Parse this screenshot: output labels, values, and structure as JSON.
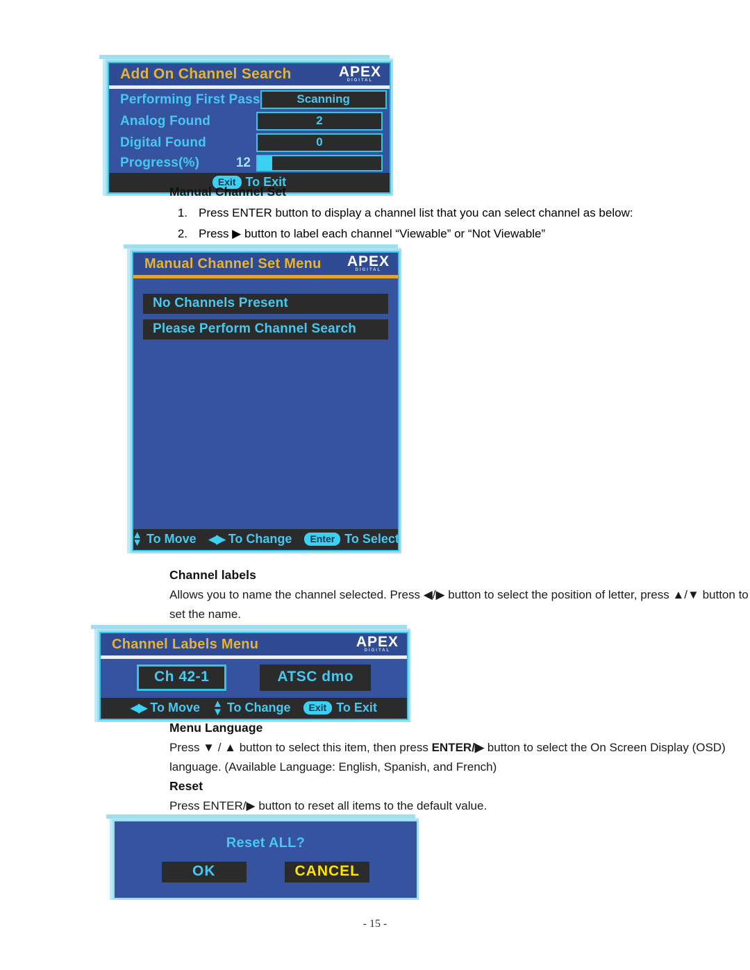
{
  "page": {
    "number": "- 15 -"
  },
  "sections": {
    "manual_channel_set": {
      "heading": "Manual Channel Set",
      "steps": [
        {
          "num": "1.",
          "text": "Press ENTER button to display a channel list that you can select channel as below:"
        },
        {
          "num": "2.",
          "text": "Press ▶ button to label each channel “Viewable” or “Not Viewable”"
        }
      ]
    },
    "channel_labels": {
      "heading": "Channel labels",
      "body": "Allows you to name the channel selected. Press ◀/▶ button to select the position of letter, press ▲/▼ button to set the name."
    },
    "menu_language": {
      "heading": "Menu Language",
      "body_part1": "Press ▼ / ▲ button to select this item, then press ",
      "body_bold": "ENTER/▶",
      "body_part2": " button to select the On Screen Display (OSD) language. (Available Language: English, Spanish, and French)"
    },
    "reset": {
      "heading": "Reset",
      "body": "Press ENTER/▶ button to reset all items to the default value."
    }
  },
  "screenshots": {
    "add_on_channel_search": {
      "title": "Add On Channel Search",
      "logo_word": "APEX",
      "logo_sub": "DIGITAL",
      "rows": [
        {
          "label": "Performing First Pass",
          "value": "Scanning"
        },
        {
          "label": "Analog  Found",
          "value": "2"
        },
        {
          "label": "Digital  Found",
          "value": "0"
        }
      ],
      "progress": {
        "label": "Progress(%)",
        "value": "12",
        "percent": 12
      },
      "footer": {
        "key": "Exit",
        "text": "To Exit"
      }
    },
    "manual_channel_set_menu": {
      "title": "Manual Channel Set  Menu",
      "logo_word": "APEX",
      "logo_sub": "DIGITAL",
      "list": [
        "No Channels Present",
        "Please Perform Channel Search"
      ],
      "footer": {
        "move_text": "To Move",
        "change_text": "To Change",
        "select_key": "Enter",
        "select_text": "To Select"
      }
    },
    "channel_labels_menu": {
      "title": "Channel Labels  Menu",
      "logo_word": "APEX",
      "logo_sub": "DIGITAL",
      "channel_box": "Ch 42-1",
      "name_box": "ATSC dmo",
      "footer": {
        "move_text": "To Move",
        "change_text": "To Change",
        "exit_key": "Exit",
        "exit_text": "To Exit"
      }
    },
    "reset_dialog": {
      "title": "Reset ALL?",
      "ok_label": "OK",
      "cancel_label": "CANCEL"
    }
  },
  "colors": {
    "osd_blue": "#35539e",
    "osd_title_gold": "#e8b233",
    "osd_cyan": "#46c8f0",
    "osd_dark": "#2b2b2b",
    "cancel_yellow": "#ffe400",
    "frame_cyan": "#2fc6e8"
  }
}
